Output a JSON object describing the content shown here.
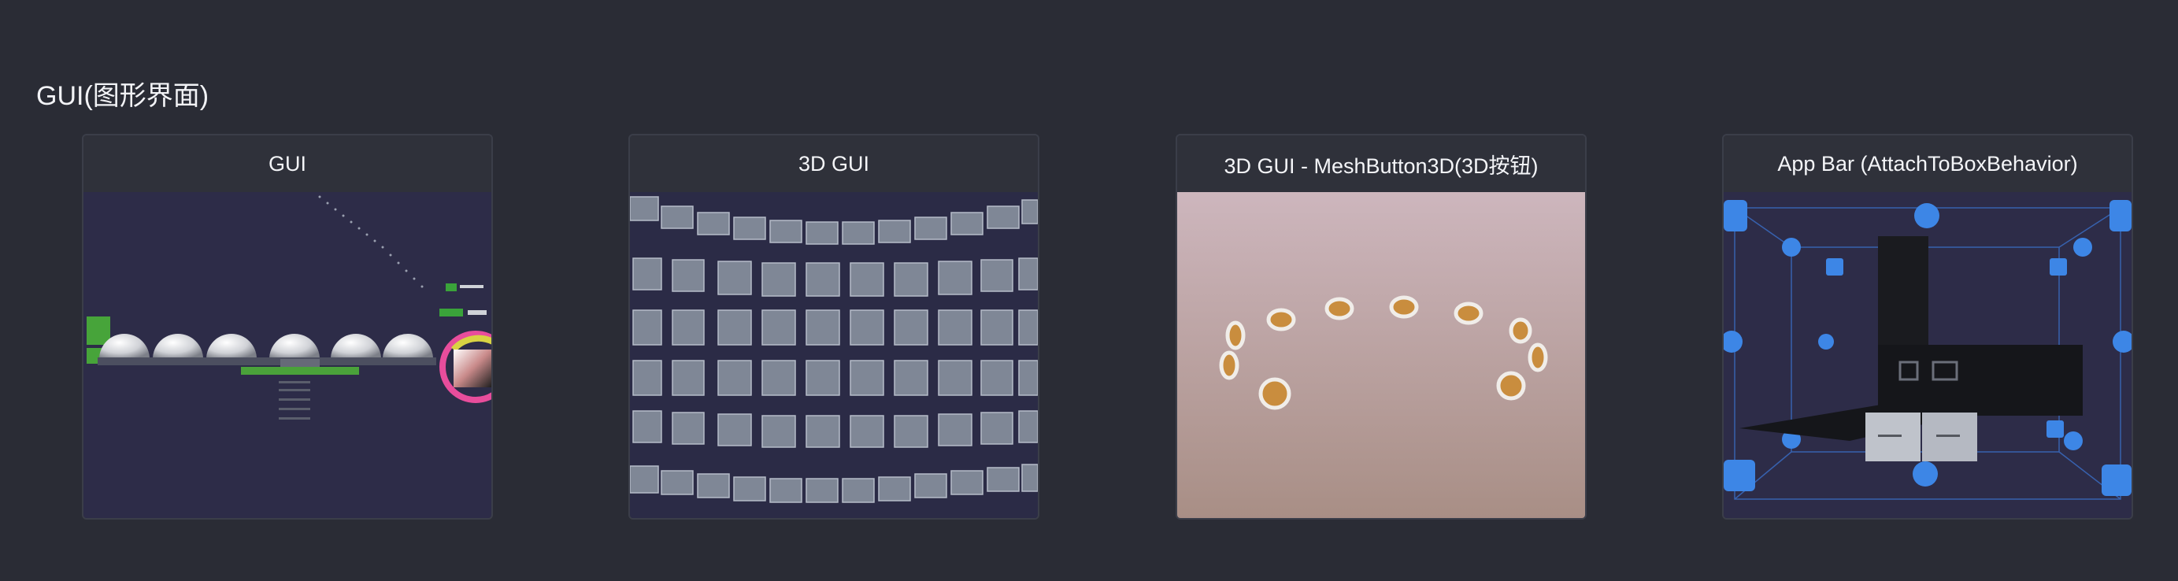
{
  "section": {
    "title": "GUI(图形界面)"
  },
  "cards": [
    {
      "title": "GUI"
    },
    {
      "title": "3D GUI"
    },
    {
      "title": "3D GUI - MeshButton3D(3D按钮)"
    },
    {
      "title": "App Bar (AttachToBoxBehavior)"
    }
  ],
  "colors": {
    "page_background": "#2a2c35",
    "card_background": "#30323c",
    "card_border": "#3b3e49",
    "text": "#f2f3f6"
  }
}
